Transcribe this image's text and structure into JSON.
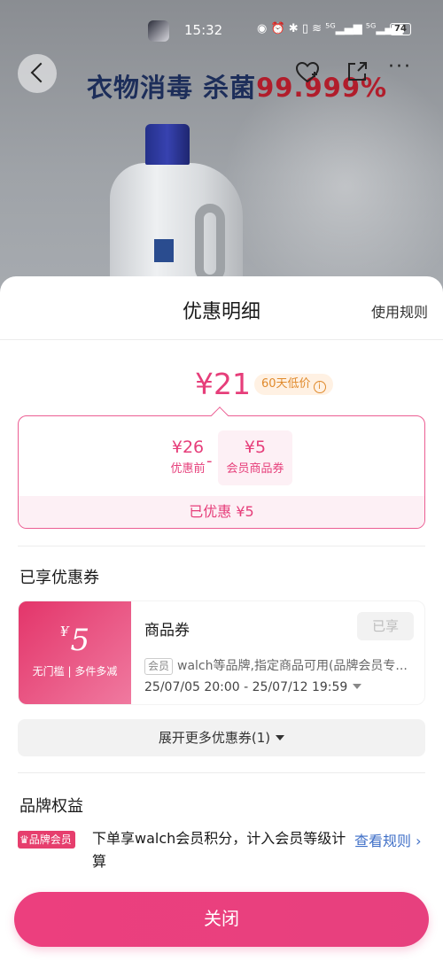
{
  "status_bar": {
    "time": "15:32",
    "icons": "◉ ⏰ ✱ ▯ ≋ ⁵ᴳ▂▄▆ ⁵ᴳ▂▄▆",
    "battery": "74",
    "battery_level": 0.74
  },
  "background": {
    "headline_prefix": "衣物消毒 杀菌",
    "headline_number": "99.999%"
  },
  "nav": {
    "more_glyph": "···",
    "icons": [
      "back-arrow-icon",
      "favorite-heart-icon",
      "share-icon",
      "more-icon"
    ]
  },
  "sheet": {
    "title": "优惠明细",
    "rules_link": "使用规则",
    "final_price": "¥21",
    "low_price_badge": "60天低价",
    "info_glyph": "i",
    "breakdown": {
      "before_value": "¥26",
      "before_label": "优惠前",
      "minus": "-",
      "coupon_value": "¥5",
      "coupon_label": "会员商品券",
      "saved": "已优惠 ¥5"
    },
    "coupons_section_title": "已享优惠券",
    "coupon": {
      "currency": "¥",
      "amount": "5",
      "condition": "无门槛 | 多件多减",
      "name": "商品券",
      "status": "已享",
      "member_tag": "会员",
      "description": "walch等品牌,指定商品可用(品牌会员专...",
      "validity": "25/07/05 20:00 - 25/07/12 19:59"
    },
    "expand_label": "展开更多优惠券(1)",
    "brand_section_title": "品牌权益",
    "brand_badge": "♛品牌会员",
    "brand_text": "下单享walch会员积分，计入会员等级计算",
    "brand_link": "查看规则 ›",
    "close_button": "关闭"
  },
  "colors": {
    "accent": "#e63e7a",
    "link": "#3f6fc7",
    "badge_text": "#e08a2c"
  }
}
